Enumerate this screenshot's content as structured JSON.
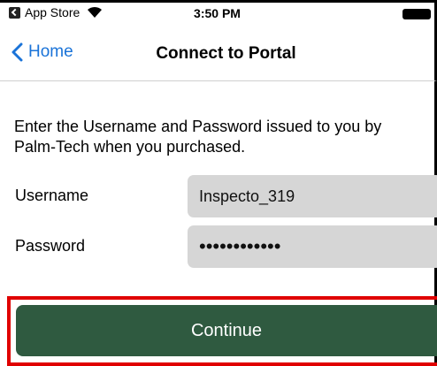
{
  "status_bar": {
    "back_app_label": "App Store",
    "time": "3:50 PM"
  },
  "nav_bar": {
    "back_label": "Home",
    "title": "Connect to Portal"
  },
  "form": {
    "instructions": "Enter the Username and Password issued to you by Palm-Tech when you purchased.",
    "username_label": "Username",
    "username_value": "Inspecto_319",
    "password_label": "Password",
    "password_value": "••••••••••••"
  },
  "actions": {
    "continue_label": "Continue"
  },
  "colors": {
    "accent_blue": "#1a73d8",
    "button_green": "#2f5a40",
    "highlight_red": "#e00000",
    "field_gray": "#d6d6d6"
  }
}
